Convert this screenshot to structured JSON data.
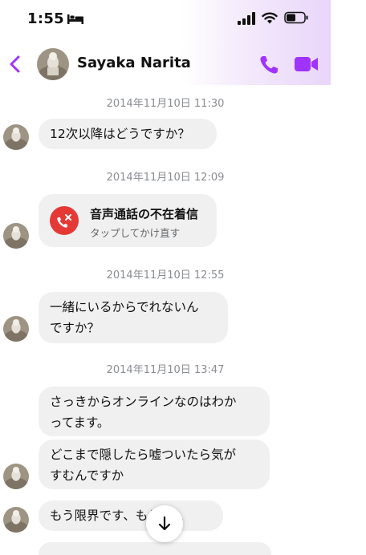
{
  "status_bar": {
    "time": "1:55"
  },
  "header": {
    "contact_name": "Sayaka Narita"
  },
  "messages": {
    "ts1": "2014年11月10日 11:30",
    "msg1": "12次以降はどうですか？",
    "ts2": "2014年11月10日 12:09",
    "missed_call_title": "音声通話の不在着信",
    "missed_call_sub": "タップしてかけ直す",
    "ts3": "2014年11月10日 12:55",
    "msg3_line1": "一緒にいるからでれないん",
    "msg3_line2": "ですか？",
    "ts4": "2014年11月10日 13:47",
    "msg4_line1": "さっきからオンラインなのはわか",
    "msg4_line2": "ってます。",
    "msg5_line1": "どこまで隠したら嘘ついたら気が",
    "msg5_line2": "すむんですか",
    "msg6": "もう限界です、もうし、、"
  },
  "colors": {
    "accent": "#a033ff",
    "missed_call": "#e53935",
    "bubble": "#f0f0f0",
    "timestamp": "#8a8d91"
  },
  "icons": [
    "bed-icon",
    "signal-icon",
    "wifi-icon",
    "battery-icon",
    "back-icon",
    "phone-icon",
    "video-icon",
    "missed-call-icon",
    "arrow-down-icon"
  ]
}
